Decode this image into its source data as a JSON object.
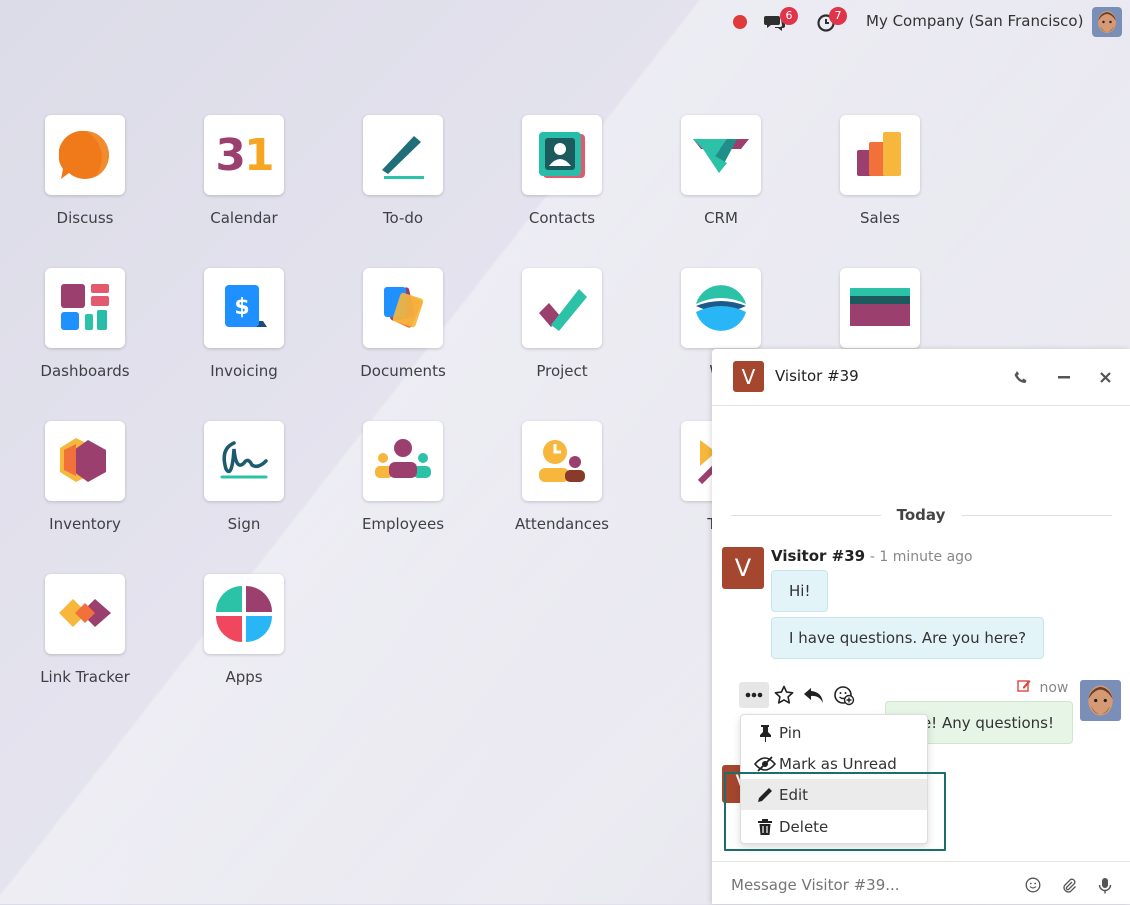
{
  "topbar": {
    "chat_badge": "6",
    "activity_badge": "7",
    "company": "My Company (San Francisco)"
  },
  "apps": [
    {
      "label": "Discuss",
      "icon": "discuss-icon"
    },
    {
      "label": "Calendar",
      "icon": "calendar-icon",
      "glyph": "31"
    },
    {
      "label": "To-do",
      "icon": "todo-icon"
    },
    {
      "label": "Contacts",
      "icon": "contacts-icon"
    },
    {
      "label": "CRM",
      "icon": "crm-icon"
    },
    {
      "label": "Sales",
      "icon": "sales-icon"
    },
    {
      "label": "Dashboards",
      "icon": "dashboards-icon"
    },
    {
      "label": "Invoicing",
      "icon": "invoicing-icon",
      "glyph": "$"
    },
    {
      "label": "Documents",
      "icon": "documents-icon"
    },
    {
      "label": "Project",
      "icon": "project-icon"
    },
    {
      "label": "We",
      "icon": "website-icon"
    },
    {
      "label": "",
      "icon": "card-icon"
    },
    {
      "label": "Inventory",
      "icon": "inventory-icon"
    },
    {
      "label": "Sign",
      "icon": "sign-icon"
    },
    {
      "label": "Employees",
      "icon": "employees-icon"
    },
    {
      "label": "Attendances",
      "icon": "attendances-icon"
    },
    {
      "label": "Tim",
      "icon": "timesheets-icon"
    },
    {
      "label": "Link Tracker",
      "icon": "link-tracker-icon"
    },
    {
      "label": "Apps",
      "icon": "apps-icon"
    }
  ],
  "chat": {
    "avatar_letter": "V",
    "title": "Visitor #39",
    "day_separator": "Today",
    "visitor_author": "Visitor #39",
    "visitor_time": "- 1 minute ago",
    "visitor_messages": [
      "Hi!",
      "I have questions. Are you here?"
    ],
    "own_time": "now",
    "own_message": "Sure! Any questions!",
    "menu": {
      "pin": "Pin",
      "mark_unread": "Mark as Unread",
      "edit": "Edit",
      "delete": "Delete"
    },
    "composer_placeholder": "Message Visitor #39..."
  },
  "colors": {
    "visitor_avatar": "#a5472f",
    "visitor_bubble": "#e3f4f8",
    "own_bubble": "#e6f5e6",
    "badge": "#e0344a",
    "focus": "#1b6e6e"
  }
}
